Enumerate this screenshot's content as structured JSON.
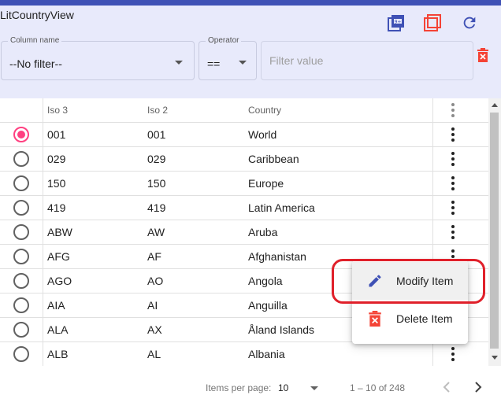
{
  "app": {
    "title": "LitCountryView"
  },
  "colors": {
    "primary": "#3f51b5",
    "accent": "#ff4081",
    "delete": "#f44336",
    "header_bg": "#e8eafb"
  },
  "header_icons": [
    "add-box-icon",
    "copy-box-icon",
    "refresh-icon"
  ],
  "filters": {
    "column": {
      "label": "Column name",
      "value": "--No filter--"
    },
    "operator": {
      "label": "Operator",
      "value": "=="
    },
    "value": {
      "placeholder": "Filter value",
      "value": ""
    },
    "clear_icon": "delete-icon"
  },
  "table": {
    "columns": [
      "Iso 3",
      "Iso 2",
      "Country"
    ],
    "selected_index": 0,
    "rows": [
      {
        "iso3": "001",
        "iso2": "001",
        "country": "World"
      },
      {
        "iso3": "029",
        "iso2": "029",
        "country": "Caribbean"
      },
      {
        "iso3": "150",
        "iso2": "150",
        "country": "Europe"
      },
      {
        "iso3": "419",
        "iso2": "419",
        "country": "Latin America"
      },
      {
        "iso3": "ABW",
        "iso2": "AW",
        "country": "Aruba"
      },
      {
        "iso3": "AFG",
        "iso2": "AF",
        "country": "Afghanistan"
      },
      {
        "iso3": "AGO",
        "iso2": "AO",
        "country": "Angola"
      },
      {
        "iso3": "AIA",
        "iso2": "AI",
        "country": "Anguilla"
      },
      {
        "iso3": "ALA",
        "iso2": "AX",
        "country": "Åland Islands"
      },
      {
        "iso3": "ALB",
        "iso2": "AL",
        "country": "Albania"
      }
    ]
  },
  "context_menu": {
    "items": [
      {
        "label": "Modify Item",
        "icon": "edit-pencil-icon"
      },
      {
        "label": "Delete Item",
        "icon": "delete-icon"
      }
    ]
  },
  "paginator": {
    "items_per_page_label": "Items per page:",
    "items_per_page": "10",
    "range": "1 – 10 of 248"
  }
}
